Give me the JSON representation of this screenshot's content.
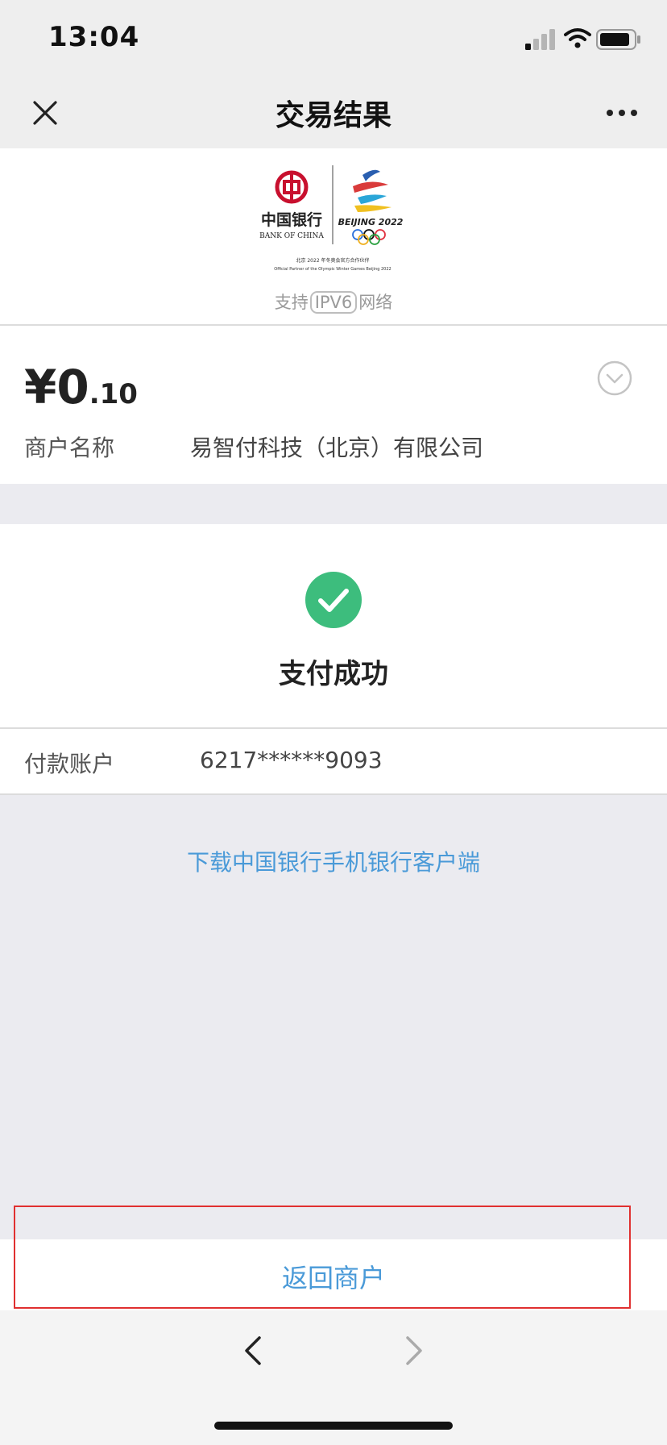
{
  "status_bar": {
    "time": "13:04"
  },
  "nav": {
    "title": "交易结果"
  },
  "brand": {
    "bank_name_cn": "中国银行",
    "bank_name_en": "BANK OF CHINA",
    "games_label": "BEIJING 2022",
    "partner_cn": "北京 2022 年冬奥会官方合作伙伴",
    "partner_en": "Official Partner of the Olympic Winter Games Beijing 2022",
    "ipv6_prefix": "支持",
    "ipv6_box": "IPV6",
    "ipv6_suffix": "网络"
  },
  "amount": {
    "currency_integer": "¥0",
    "decimal": ".10"
  },
  "merchant": {
    "label": "商户名称",
    "value": "易智付科技（北京）有限公司"
  },
  "status": {
    "text": "支付成功"
  },
  "account": {
    "label": "付款账户",
    "value": "6217******9093"
  },
  "links": {
    "download_app": "下载中国银行手机银行客户端"
  },
  "actions": {
    "return_label": "返回商户"
  },
  "colors": {
    "link_blue": "#4a9ad8",
    "success_green": "#3dbd7d",
    "boc_red": "#c8102e",
    "highlight_red": "#e03030"
  },
  "icons": [
    "close-icon",
    "more-icon",
    "signal-icon",
    "wifi-icon",
    "battery-icon",
    "chevron-down-icon",
    "check-icon",
    "back-arrow-icon",
    "forward-arrow-icon"
  ]
}
